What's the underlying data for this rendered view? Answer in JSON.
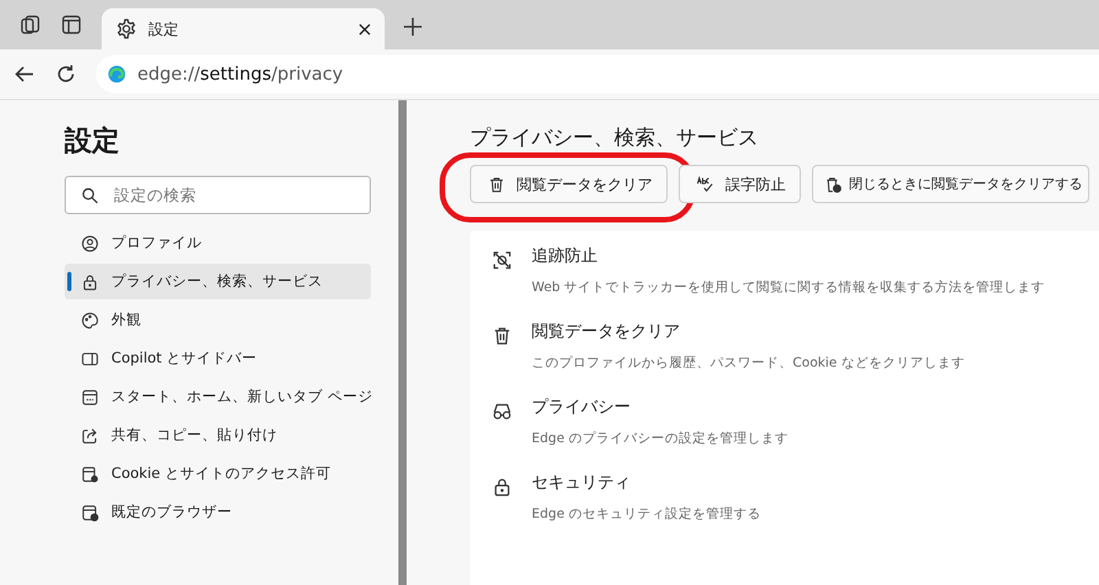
{
  "tab": {
    "title": "設定"
  },
  "address": {
    "scheme": "edge://",
    "host": "settings",
    "path": "/privacy"
  },
  "sidebar": {
    "title": "設定",
    "search": {
      "placeholder": "設定の検索"
    },
    "items": [
      {
        "label": "プロファイル",
        "selected": false
      },
      {
        "label": "プライバシー、検索、サービス",
        "selected": true
      },
      {
        "label": "外観",
        "selected": false
      },
      {
        "label": "Copilot とサイドバー",
        "selected": false
      },
      {
        "label": "スタート、ホーム、新しいタブ ページ",
        "selected": false
      },
      {
        "label": "共有、コピー、貼り付け",
        "selected": false
      },
      {
        "label": "Cookie とサイトのアクセス許可",
        "selected": false
      },
      {
        "label": "既定のブラウザー",
        "selected": false
      }
    ]
  },
  "main": {
    "title": "プライバシー、検索、サービス",
    "toolbar": [
      {
        "label": "閲覧データをクリア",
        "circled": true
      },
      {
        "label": "誤字防止",
        "circled": false
      },
      {
        "label": "閉じるときに閲覧データをクリアする",
        "circled": false
      }
    ],
    "sections": [
      {
        "title": "追跡防止",
        "description": "Web サイトでトラッカーを使用して閲覧に関する情報を収集する方法を管理します"
      },
      {
        "title": "閲覧データをクリア",
        "description": "このプロファイルから履歴、パスワード、Cookie などをクリアします"
      },
      {
        "title": "プライバシー",
        "description": "Edge のプライバシーの設定を管理します"
      },
      {
        "title": "セキュリティ",
        "description": "Edge のセキュリティ設定を管理する"
      }
    ]
  }
}
